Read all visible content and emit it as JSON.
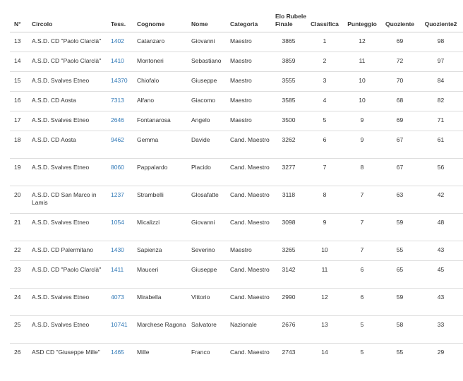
{
  "table": {
    "headers": {
      "n": "N°",
      "circolo": "Circolo",
      "tess": "Tess.",
      "cognome": "Cognome",
      "nome": "Nome",
      "categoria": "Categoria",
      "elo": "Elo Rubele Finale",
      "classifica": "Classifica",
      "punteggio": "Punteggio",
      "quoziente": "Quoziente",
      "quoziente2": "Quoziente2"
    },
    "rows": [
      {
        "n": "13",
        "circolo": "A.S.D. CD \"Paolo Clarclà\"",
        "tess": "1402",
        "cognome": "Catanzaro",
        "nome": "Giovanni",
        "categoria": "Maestro",
        "elo": "3865",
        "classifica": "1",
        "punteggio": "12",
        "quoziente": "69",
        "quoziente2": "98"
      },
      {
        "n": "14",
        "circolo": "A.S.D. CD \"Paolo Clarclà\"",
        "tess": "1410",
        "cognome": "Montoneri",
        "nome": "Sebastiano",
        "categoria": "Maestro",
        "elo": "3859",
        "classifica": "2",
        "punteggio": "11",
        "quoziente": "72",
        "quoziente2": "97"
      },
      {
        "n": "15",
        "circolo": "A.S.D. Svalves Etneo",
        "tess": "14370",
        "cognome": "Chiofalo",
        "nome": "Giuseppe",
        "categoria": "Maestro",
        "elo": "3555",
        "classifica": "3",
        "punteggio": "10",
        "quoziente": "70",
        "quoziente2": "84"
      },
      {
        "n": "16",
        "circolo": "A.S.D. CD Aosta",
        "tess": "7313",
        "cognome": "Alfano",
        "nome": "Giacomo",
        "categoria": "Maestro",
        "elo": "3585",
        "classifica": "4",
        "punteggio": "10",
        "quoziente": "68",
        "quoziente2": "82"
      },
      {
        "n": "17",
        "circolo": "A.S.D. Svalves Etneo",
        "tess": "2646",
        "cognome": "Fontanarosa",
        "nome": "Angelo",
        "categoria": "Maestro",
        "elo": "3500",
        "classifica": "5",
        "punteggio": "9",
        "quoziente": "69",
        "quoziente2": "71"
      },
      {
        "n": "18",
        "circolo": "A.S.D. CD Aosta",
        "tess": "9462",
        "cognome": "Gemma",
        "nome": "Davide",
        "categoria": "Cand. Maestro",
        "elo": "3262",
        "classifica": "6",
        "punteggio": "9",
        "quoziente": "67",
        "quoziente2": "61"
      },
      {
        "n": "19",
        "circolo": "A.S.D. Svalves Etneo",
        "tess": "8060",
        "cognome": "Pappalardo",
        "nome": "Placido",
        "categoria": "Cand. Maestro",
        "elo": "3277",
        "classifica": "7",
        "punteggio": "8",
        "quoziente": "67",
        "quoziente2": "56"
      },
      {
        "n": "20",
        "circolo": "A.S.D. CD San Marco in Lamis",
        "tess": "1237",
        "cognome": "Strambelli",
        "nome": "Glosafatte",
        "categoria": "Cand. Maestro",
        "elo": "3118",
        "classifica": "8",
        "punteggio": "7",
        "quoziente": "63",
        "quoziente2": "42"
      },
      {
        "n": "21",
        "circolo": "A.S.D. Svalves Etneo",
        "tess": "1054",
        "cognome": "Micalizzi",
        "nome": "Giovanni",
        "categoria": "Cand. Maestro",
        "elo": "3098",
        "classifica": "9",
        "punteggio": "7",
        "quoziente": "59",
        "quoziente2": "48"
      },
      {
        "n": "22",
        "circolo": "A.S.D. CD Palermitano",
        "tess": "1430",
        "cognome": "Sapienza",
        "nome": "Severino",
        "categoria": "Maestro",
        "elo": "3265",
        "classifica": "10",
        "punteggio": "7",
        "quoziente": "55",
        "quoziente2": "43"
      },
      {
        "n": "23",
        "circolo": "A.S.D. CD \"Paolo Clarclà\"",
        "tess": "1411",
        "cognome": "Mauceri",
        "nome": "Giuseppe",
        "categoria": "Cand. Maestro",
        "elo": "3142",
        "classifica": "11",
        "punteggio": "6",
        "quoziente": "65",
        "quoziente2": "45"
      },
      {
        "n": "24",
        "circolo": "A.S.D. Svalves Etneo",
        "tess": "4073",
        "cognome": "Mirabella",
        "nome": "Vittorio",
        "categoria": "Cand. Maestro",
        "elo": "2990",
        "classifica": "12",
        "punteggio": "6",
        "quoziente": "59",
        "quoziente2": "43"
      },
      {
        "n": "25",
        "circolo": "A.S.D. Svalves Etneo",
        "tess": "10741",
        "cognome": "Marchese Ragona",
        "nome": "Salvatore",
        "categoria": "Nazionale",
        "elo": "2676",
        "classifica": "13",
        "punteggio": "5",
        "quoziente": "58",
        "quoziente2": "33"
      },
      {
        "n": "26",
        "circolo": "ASD CD \"Giuseppe Mille\"",
        "tess": "1465",
        "cognome": "Mille",
        "nome": "Franco",
        "categoria": "Cand. Maestro",
        "elo": "2743",
        "classifica": "14",
        "punteggio": "5",
        "quoziente": "55",
        "quoziente2": "29"
      }
    ]
  }
}
